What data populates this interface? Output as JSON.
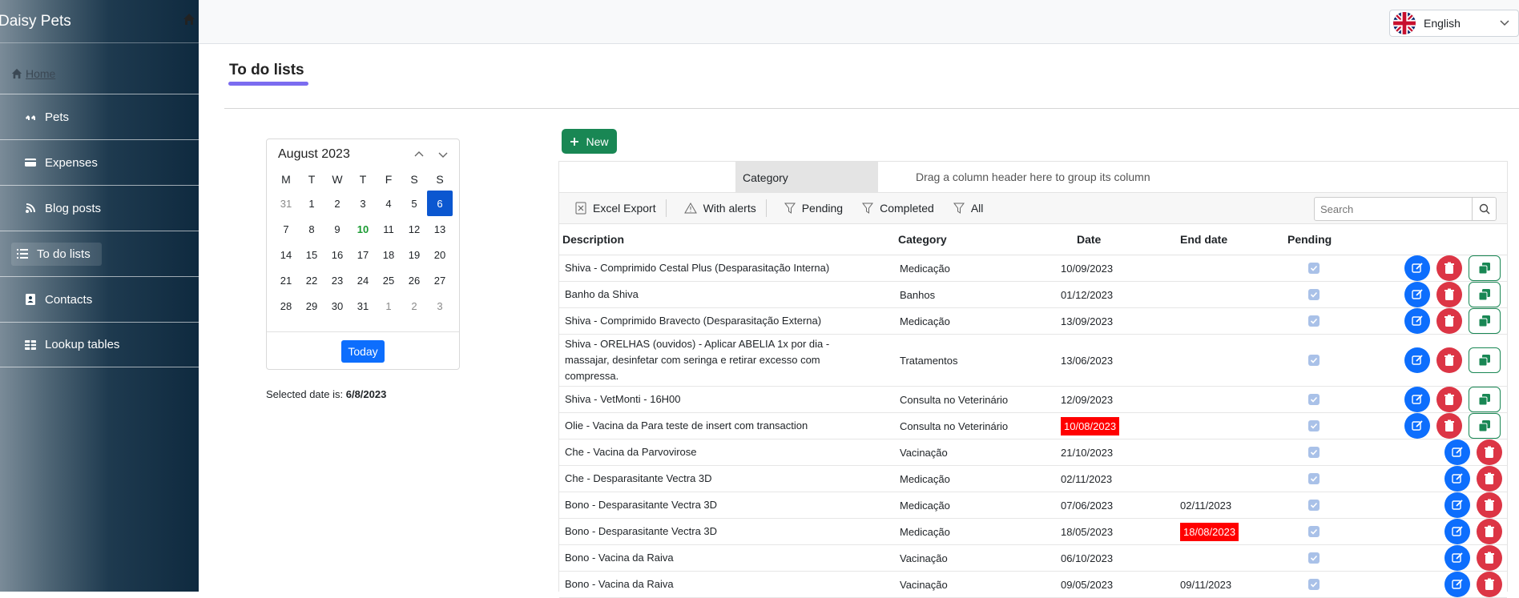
{
  "app": {
    "title": "Daisy Pets"
  },
  "sidebar": {
    "home_label": "Home",
    "items": [
      {
        "label": "Pets",
        "icon": "paw-dogs-icon"
      },
      {
        "label": "Expenses",
        "icon": "credit-card-icon"
      },
      {
        "label": "Blog posts",
        "icon": "blog-icon"
      },
      {
        "label": "To do lists",
        "icon": "list-icon",
        "active": true
      },
      {
        "label": "Contacts",
        "icon": "contact-card-icon"
      },
      {
        "label": "Lookup tables",
        "icon": "table-icon"
      }
    ]
  },
  "language": {
    "selected": "English",
    "flag": "uk-flag-icon"
  },
  "page": {
    "title": "To do lists"
  },
  "calendar": {
    "month_label": "August 2023",
    "weekdays": [
      "M",
      "T",
      "W",
      "T",
      "F",
      "S",
      "S"
    ],
    "weeks": [
      [
        "31",
        "1",
        "2",
        "3",
        "4",
        "5",
        "6"
      ],
      [
        "7",
        "8",
        "9",
        "10",
        "11",
        "12",
        "13"
      ],
      [
        "14",
        "15",
        "16",
        "17",
        "18",
        "19",
        "20"
      ],
      [
        "21",
        "22",
        "23",
        "24",
        "25",
        "26",
        "27"
      ],
      [
        "28",
        "29",
        "30",
        "31",
        "1",
        "2",
        "3"
      ]
    ],
    "selected_day": "6",
    "today_day": "10",
    "today_button": "Today",
    "selected_date_prefix": "Selected date is: ",
    "selected_date": "6/8/2023"
  },
  "grid": {
    "new_button": "New",
    "group_chip": "Category",
    "group_hint": "Drag a column header here to group its column",
    "toolbar": {
      "excel_export": "Excel Export",
      "with_alerts": "With alerts",
      "pending": "Pending",
      "completed": "Completed",
      "all": "All"
    },
    "search_placeholder": "Search",
    "columns": {
      "description": "Description",
      "category": "Category",
      "date": "Date",
      "end_date": "End date",
      "pending": "Pending"
    },
    "rows": [
      {
        "description": "Shiva - Comprimido Cestal Plus (Desparasitação Interna)",
        "category": "Medicação",
        "date": "10/09/2023",
        "end_date": "",
        "date_alert": false,
        "end_alert": false,
        "copy": true
      },
      {
        "description": "Banho da Shiva",
        "category": "Banhos",
        "date": "01/12/2023",
        "end_date": "",
        "date_alert": false,
        "end_alert": false,
        "copy": true
      },
      {
        "description": "Shiva - Comprimido Bravecto (Desparasitação Externa)",
        "category": "Medicação",
        "date": "13/09/2023",
        "end_date": "",
        "date_alert": false,
        "end_alert": false,
        "copy": true
      },
      {
        "description": "Shiva - ORELHAS (ouvidos) - Aplicar ABELIA 1x por dia - massajar, desinfetar com seringa e retirar excesso com compressa.",
        "category": "Tratamentos",
        "date": "13/06/2023",
        "end_date": "",
        "date_alert": false,
        "end_alert": false,
        "copy": true,
        "tall": true
      },
      {
        "description": "Shiva - VetMonti - 16H00",
        "category": "Consulta no Veterinário",
        "date": "12/09/2023",
        "end_date": "",
        "date_alert": false,
        "end_alert": false,
        "copy": true
      },
      {
        "description": "Olie - Vacina da Para teste de insert com transaction",
        "category": "Consulta no Veterinário",
        "date": "10/08/2023",
        "end_date": "",
        "date_alert": true,
        "end_alert": false,
        "copy": true
      },
      {
        "description": "Che - Vacina da Parvovirose",
        "category": "Vacinação",
        "date": "21/10/2023",
        "end_date": "",
        "date_alert": false,
        "end_alert": false,
        "copy": false
      },
      {
        "description": "Che - Desparasitante Vectra 3D",
        "category": "Medicação",
        "date": "02/11/2023",
        "end_date": "",
        "date_alert": false,
        "end_alert": false,
        "copy": false
      },
      {
        "description": "Bono - Desparasitante Vectra 3D",
        "category": "Medicação",
        "date": "07/06/2023",
        "end_date": "02/11/2023",
        "date_alert": false,
        "end_alert": false,
        "copy": false
      },
      {
        "description": "Bono - Desparasitante Vectra 3D",
        "category": "Medicação",
        "date": "18/05/2023",
        "end_date": "18/08/2023",
        "date_alert": false,
        "end_alert": true,
        "copy": false
      },
      {
        "description": "Bono - Vacina da Raiva",
        "category": "Vacinação",
        "date": "06/10/2023",
        "end_date": "",
        "date_alert": false,
        "end_alert": false,
        "copy": false
      },
      {
        "description": "Bono - Vacina da Raiva",
        "category": "Vacinação",
        "date": "09/05/2023",
        "end_date": "09/11/2023",
        "date_alert": false,
        "end_alert": false,
        "copy": false
      }
    ]
  },
  "colors": {
    "new_button": "#198754",
    "edit_button": "#0d6efd",
    "delete_button": "#dc3545",
    "alert": "#ff0000",
    "title_underline": "#7b6cf0",
    "calendar_selected": "#0b57d0",
    "calendar_today": "#1a9b32"
  }
}
